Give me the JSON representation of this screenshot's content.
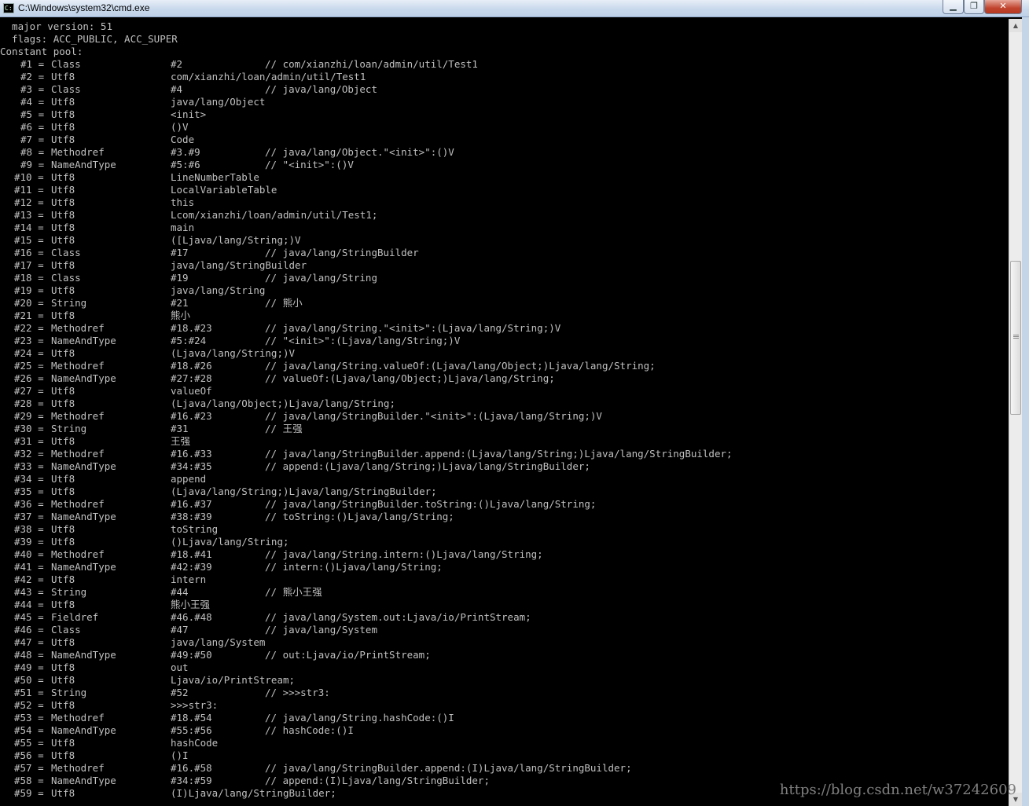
{
  "window": {
    "title": "C:\\Windows\\system32\\cmd.exe",
    "icon_name": "cmd-icon",
    "controls": {
      "minimize": "▁",
      "maximize": "❐",
      "close": "✕"
    }
  },
  "console": {
    "header": [
      "  major version: 51",
      "  flags: ACC_PUBLIC, ACC_SUPER",
      "Constant pool:"
    ],
    "entries": [
      {
        "num": "#1 =",
        "type": "Class",
        "value": "#2",
        "comment": "// com/xianzhi/loan/admin/util/Test1"
      },
      {
        "num": "#2 =",
        "type": "Utf8",
        "value": "com/xianzhi/loan/admin/util/Test1",
        "comment": ""
      },
      {
        "num": "#3 =",
        "type": "Class",
        "value": "#4",
        "comment": "// java/lang/Object"
      },
      {
        "num": "#4 =",
        "type": "Utf8",
        "value": "java/lang/Object",
        "comment": ""
      },
      {
        "num": "#5 =",
        "type": "Utf8",
        "value": "<init>",
        "comment": ""
      },
      {
        "num": "#6 =",
        "type": "Utf8",
        "value": "()V",
        "comment": ""
      },
      {
        "num": "#7 =",
        "type": "Utf8",
        "value": "Code",
        "comment": ""
      },
      {
        "num": "#8 =",
        "type": "Methodref",
        "value": "#3.#9",
        "comment": "// java/lang/Object.\"<init>\":()V"
      },
      {
        "num": "#9 =",
        "type": "NameAndType",
        "value": "#5:#6",
        "comment": "// \"<init>\":()V"
      },
      {
        "num": "#10 =",
        "type": "Utf8",
        "value": "LineNumberTable",
        "comment": ""
      },
      {
        "num": "#11 =",
        "type": "Utf8",
        "value": "LocalVariableTable",
        "comment": ""
      },
      {
        "num": "#12 =",
        "type": "Utf8",
        "value": "this",
        "comment": ""
      },
      {
        "num": "#13 =",
        "type": "Utf8",
        "value": "Lcom/xianzhi/loan/admin/util/Test1;",
        "comment": ""
      },
      {
        "num": "#14 =",
        "type": "Utf8",
        "value": "main",
        "comment": ""
      },
      {
        "num": "#15 =",
        "type": "Utf8",
        "value": "([Ljava/lang/String;)V",
        "comment": ""
      },
      {
        "num": "#16 =",
        "type": "Class",
        "value": "#17",
        "comment": "// java/lang/StringBuilder"
      },
      {
        "num": "#17 =",
        "type": "Utf8",
        "value": "java/lang/StringBuilder",
        "comment": ""
      },
      {
        "num": "#18 =",
        "type": "Class",
        "value": "#19",
        "comment": "// java/lang/String"
      },
      {
        "num": "#19 =",
        "type": "Utf8",
        "value": "java/lang/String",
        "comment": ""
      },
      {
        "num": "#20 =",
        "type": "String",
        "value": "#21",
        "comment": "// 熊小"
      },
      {
        "num": "#21 =",
        "type": "Utf8",
        "value": "熊小",
        "comment": ""
      },
      {
        "num": "#22 =",
        "type": "Methodref",
        "value": "#18.#23",
        "comment": "// java/lang/String.\"<init>\":(Ljava/lang/String;)V"
      },
      {
        "num": "#23 =",
        "type": "NameAndType",
        "value": "#5:#24",
        "comment": "// \"<init>\":(Ljava/lang/String;)V"
      },
      {
        "num": "#24 =",
        "type": "Utf8",
        "value": "(Ljava/lang/String;)V",
        "comment": ""
      },
      {
        "num": "#25 =",
        "type": "Methodref",
        "value": "#18.#26",
        "comment": "// java/lang/String.valueOf:(Ljava/lang/Object;)Ljava/lang/String;"
      },
      {
        "num": "#26 =",
        "type": "NameAndType",
        "value": "#27:#28",
        "comment": "// valueOf:(Ljava/lang/Object;)Ljava/lang/String;"
      },
      {
        "num": "#27 =",
        "type": "Utf8",
        "value": "valueOf",
        "comment": ""
      },
      {
        "num": "#28 =",
        "type": "Utf8",
        "value": "(Ljava/lang/Object;)Ljava/lang/String;",
        "comment": ""
      },
      {
        "num": "#29 =",
        "type": "Methodref",
        "value": "#16.#23",
        "comment": "// java/lang/StringBuilder.\"<init>\":(Ljava/lang/String;)V"
      },
      {
        "num": "#30 =",
        "type": "String",
        "value": "#31",
        "comment": "// 王强"
      },
      {
        "num": "#31 =",
        "type": "Utf8",
        "value": "王强",
        "comment": ""
      },
      {
        "num": "#32 =",
        "type": "Methodref",
        "value": "#16.#33",
        "comment": "// java/lang/StringBuilder.append:(Ljava/lang/String;)Ljava/lang/StringBuilder;"
      },
      {
        "num": "#33 =",
        "type": "NameAndType",
        "value": "#34:#35",
        "comment": "// append:(Ljava/lang/String;)Ljava/lang/StringBuilder;"
      },
      {
        "num": "#34 =",
        "type": "Utf8",
        "value": "append",
        "comment": ""
      },
      {
        "num": "#35 =",
        "type": "Utf8",
        "value": "(Ljava/lang/String;)Ljava/lang/StringBuilder;",
        "comment": ""
      },
      {
        "num": "#36 =",
        "type": "Methodref",
        "value": "#16.#37",
        "comment": "// java/lang/StringBuilder.toString:()Ljava/lang/String;"
      },
      {
        "num": "#37 =",
        "type": "NameAndType",
        "value": "#38:#39",
        "comment": "// toString:()Ljava/lang/String;"
      },
      {
        "num": "#38 =",
        "type": "Utf8",
        "value": "toString",
        "comment": ""
      },
      {
        "num": "#39 =",
        "type": "Utf8",
        "value": "()Ljava/lang/String;",
        "comment": ""
      },
      {
        "num": "#40 =",
        "type": "Methodref",
        "value": "#18.#41",
        "comment": "// java/lang/String.intern:()Ljava/lang/String;"
      },
      {
        "num": "#41 =",
        "type": "NameAndType",
        "value": "#42:#39",
        "comment": "// intern:()Ljava/lang/String;"
      },
      {
        "num": "#42 =",
        "type": "Utf8",
        "value": "intern",
        "comment": ""
      },
      {
        "num": "#43 =",
        "type": "String",
        "value": "#44",
        "comment": "// 熊小王强"
      },
      {
        "num": "#44 =",
        "type": "Utf8",
        "value": "熊小王强",
        "comment": ""
      },
      {
        "num": "#45 =",
        "type": "Fieldref",
        "value": "#46.#48",
        "comment": "// java/lang/System.out:Ljava/io/PrintStream;"
      },
      {
        "num": "#46 =",
        "type": "Class",
        "value": "#47",
        "comment": "// java/lang/System"
      },
      {
        "num": "#47 =",
        "type": "Utf8",
        "value": "java/lang/System",
        "comment": ""
      },
      {
        "num": "#48 =",
        "type": "NameAndType",
        "value": "#49:#50",
        "comment": "// out:Ljava/io/PrintStream;"
      },
      {
        "num": "#49 =",
        "type": "Utf8",
        "value": "out",
        "comment": ""
      },
      {
        "num": "#50 =",
        "type": "Utf8",
        "value": "Ljava/io/PrintStream;",
        "comment": ""
      },
      {
        "num": "#51 =",
        "type": "String",
        "value": "#52",
        "comment": "// >>>str3:"
      },
      {
        "num": "#52 =",
        "type": "Utf8",
        "value": ">>>str3:",
        "comment": ""
      },
      {
        "num": "#53 =",
        "type": "Methodref",
        "value": "#18.#54",
        "comment": "// java/lang/String.hashCode:()I"
      },
      {
        "num": "#54 =",
        "type": "NameAndType",
        "value": "#55:#56",
        "comment": "// hashCode:()I"
      },
      {
        "num": "#55 =",
        "type": "Utf8",
        "value": "hashCode",
        "comment": ""
      },
      {
        "num": "#56 =",
        "type": "Utf8",
        "value": "()I",
        "comment": ""
      },
      {
        "num": "#57 =",
        "type": "Methodref",
        "value": "#16.#58",
        "comment": "// java/lang/StringBuilder.append:(I)Ljava/lang/StringBuilder;"
      },
      {
        "num": "#58 =",
        "type": "NameAndType",
        "value": "#34:#59",
        "comment": "// append:(I)Ljava/lang/StringBuilder;"
      },
      {
        "num": "#59 =",
        "type": "Utf8",
        "value": "(I)Ljava/lang/StringBuilder;",
        "comment": ""
      }
    ]
  },
  "watermark": "https://blog.csdn.net/w37242609",
  "colors": {
    "console_bg": "#000000",
    "console_text": "#c0c0c0",
    "titlebar": "#c9d9ec",
    "close_button": "#c1452f"
  }
}
